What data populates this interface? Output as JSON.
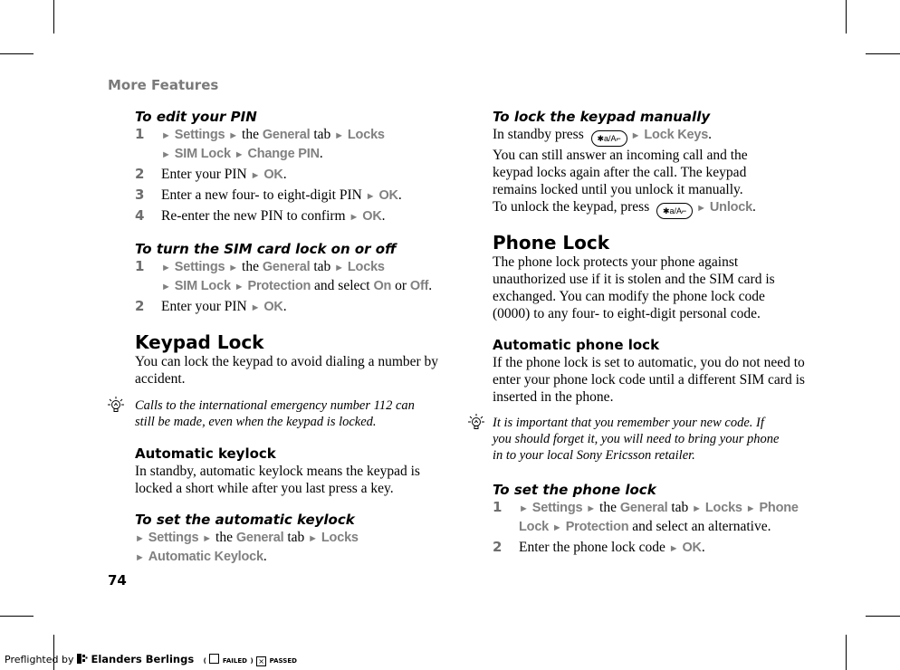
{
  "header": {
    "running_title": "More Features",
    "page_number": "74"
  },
  "left_column": {
    "edit_pin": {
      "title": "To edit your PIN",
      "steps": [
        {
          "num": "1",
          "parts": [
            "Settings",
            "the",
            "General",
            "tab",
            "Locks",
            "SIM Lock",
            "Change PIN"
          ]
        },
        {
          "num": "2",
          "text": "Enter your PIN",
          "action": "OK"
        },
        {
          "num": "3",
          "text": "Enter a new four- to eight-digit PIN",
          "action": "OK"
        },
        {
          "num": "4",
          "text": "Re-enter the new PIN to confirm",
          "action": "OK"
        }
      ]
    },
    "sim_lock": {
      "title": "To turn the SIM card lock on or off",
      "steps": [
        {
          "num": "1",
          "menu": [
            "Settings",
            "General",
            "Locks",
            "SIM Lock",
            "Protection"
          ],
          "text_the": "the",
          "text_tab": "tab",
          "text_select": "and select",
          "opt_on": "On",
          "text_or": "or",
          "opt_off": "Off"
        },
        {
          "num": "2",
          "text": "Enter your PIN",
          "action": "OK"
        }
      ]
    },
    "keypad_lock": {
      "title": "Keypad Lock",
      "body": "You can lock the keypad to avoid dialing a number by accident.",
      "tip": "Calls to the international emergency number 112 can still be made, even when the keypad is locked."
    },
    "automatic_keylock": {
      "title": "Automatic keylock",
      "body": "In standby, automatic keylock means the keypad is locked a short while after you last press a key."
    },
    "set_auto_keylock": {
      "title": "To set the automatic keylock",
      "menu": [
        "Settings",
        "General",
        "Locks",
        "Automatic Keylock"
      ],
      "text_the": "the",
      "text_tab": "tab"
    }
  },
  "right_column": {
    "lock_manual": {
      "title": "To lock the keypad manually",
      "line1_text": "In standby press",
      "key_label": "✱a/A⌐",
      "line1_action": "Lock Keys",
      "body": "You can still answer an incoming call and the keypad locks again after the call. The keypad remains locked until you unlock it manually.",
      "unlock_text": "To unlock the keypad, press",
      "unlock_action": "Unlock"
    },
    "phone_lock": {
      "title": "Phone Lock",
      "body": "The phone lock protects your phone against unauthorized use if it is stolen and the SIM card is exchanged. You can modify the phone lock code (0000) to any four- to eight-digit personal code."
    },
    "auto_phone_lock": {
      "title": "Automatic phone lock",
      "body": "If the phone lock is set to automatic, you do not need to enter your phone lock code until a different SIM card is inserted in the phone.",
      "tip": "It is important that you remember your new code. If you should forget it, you will need to bring your phone in to your local Sony Ericsson retailer."
    },
    "set_phone_lock": {
      "title": "To set the phone lock",
      "steps": [
        {
          "num": "1",
          "menu": [
            "Settings",
            "General",
            "Locks",
            "Phone Lock",
            "Protection"
          ],
          "text_the": "the",
          "text_tab": "tab",
          "text_select": "and select an alternative."
        },
        {
          "num": "2",
          "text": "Enter the phone lock code",
          "action": "OK"
        }
      ]
    }
  },
  "footer": {
    "preflighted_by": "Preflighted by",
    "brand": "Elanders Berlings",
    "failed": "FAILED",
    "passed": "PASSED"
  }
}
